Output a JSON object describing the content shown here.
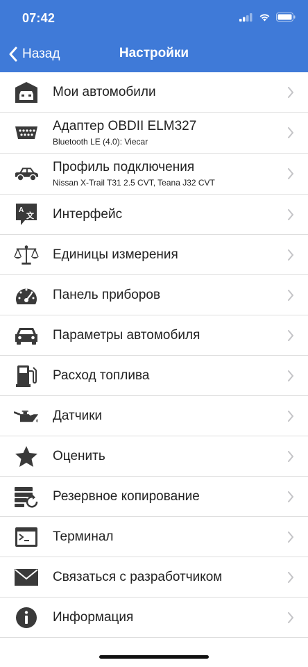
{
  "status": {
    "time": "07:42"
  },
  "nav": {
    "back_label": "Назад",
    "title": "Настройки"
  },
  "items": [
    {
      "label": "Мои автомобили",
      "icon": "garage-icon"
    },
    {
      "label": "Адаптер OBDII ELM327",
      "sub": "Bluetooth LE (4.0): Viecar",
      "icon": "obd-connector-icon"
    },
    {
      "label": "Профиль подключения",
      "sub": "Nissan X-Trail T31 2.5 CVT, Teana J32 CVT",
      "icon": "car-side-icon"
    },
    {
      "label": "Интерфейс",
      "icon": "language-icon"
    },
    {
      "label": "Единицы измерения",
      "icon": "balance-scale-icon"
    },
    {
      "label": "Панель приборов",
      "icon": "gauge-icon"
    },
    {
      "label": "Параметры автомобиля",
      "icon": "car-front-icon"
    },
    {
      "label": "Расход топлива",
      "icon": "fuel-pump-icon"
    },
    {
      "label": "Датчики",
      "icon": "oil-can-icon"
    },
    {
      "label": "Оценить",
      "icon": "star-icon"
    },
    {
      "label": "Резервное копирование",
      "icon": "backup-icon"
    },
    {
      "label": "Терминал",
      "icon": "terminal-icon"
    },
    {
      "label": "Связаться с разработчиком",
      "icon": "envelope-icon"
    },
    {
      "label": "Информация",
      "icon": "info-icon"
    }
  ]
}
